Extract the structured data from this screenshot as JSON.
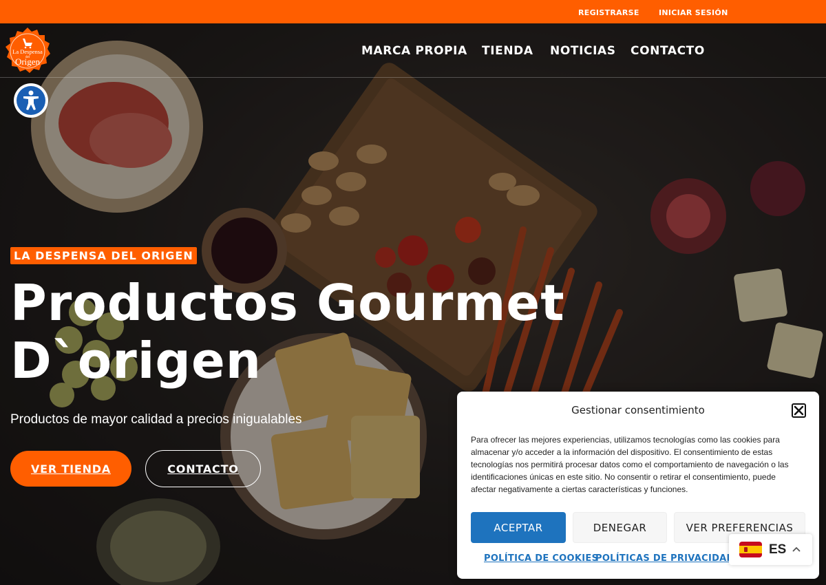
{
  "topbar": {
    "register": "REGISTRARSE",
    "login": "INICIAR SESIÓN"
  },
  "brand": {
    "logo_text_1": "La Despensa",
    "logo_text_2": "del",
    "logo_text_3": "Origen",
    "color": "#ff5e00"
  },
  "nav": {
    "items": [
      "MARCA PROPIA",
      "TIENDA",
      "NOTICIAS",
      "CONTACTO"
    ]
  },
  "hero": {
    "badge": "LA DESPENSA DEL ORIGEN",
    "headline_line1": "Productos Gourmet",
    "headline_line2": "D`origen",
    "subtitle": "Productos de mayor calidad a precios inigualables",
    "btn_shop": "VER TIENDA",
    "btn_contact": "CONTACTO"
  },
  "consent": {
    "title": "Gestionar consentimiento",
    "body": "Para ofrecer las mejores experiencias, utilizamos tecnologías como las cookies para almacenar y/o acceder a la información del dispositivo. El consentimiento de estas tecnologías nos permitirá procesar datos como el comportamiento de navegación o las identificaciones únicas en este sitio. No consentir o retirar el consentimiento, puede afectar negativamente a ciertas características y funciones.",
    "accept": "ACEPTAR",
    "deny": "DENEGAR",
    "preferences": "VER PREFERENCIAS",
    "cookie_policy": "POLÍTICA DE COOKIES",
    "privacy_policy": "POLÍTICAS DE PRIVACIDAD",
    "accent": "#1e73be"
  },
  "language": {
    "code": "ES",
    "flag": "spain-flag-icon"
  },
  "icons": {
    "accessibility": "accessibility-icon",
    "close": "close-icon",
    "chevron": "chevron-up-icon"
  }
}
